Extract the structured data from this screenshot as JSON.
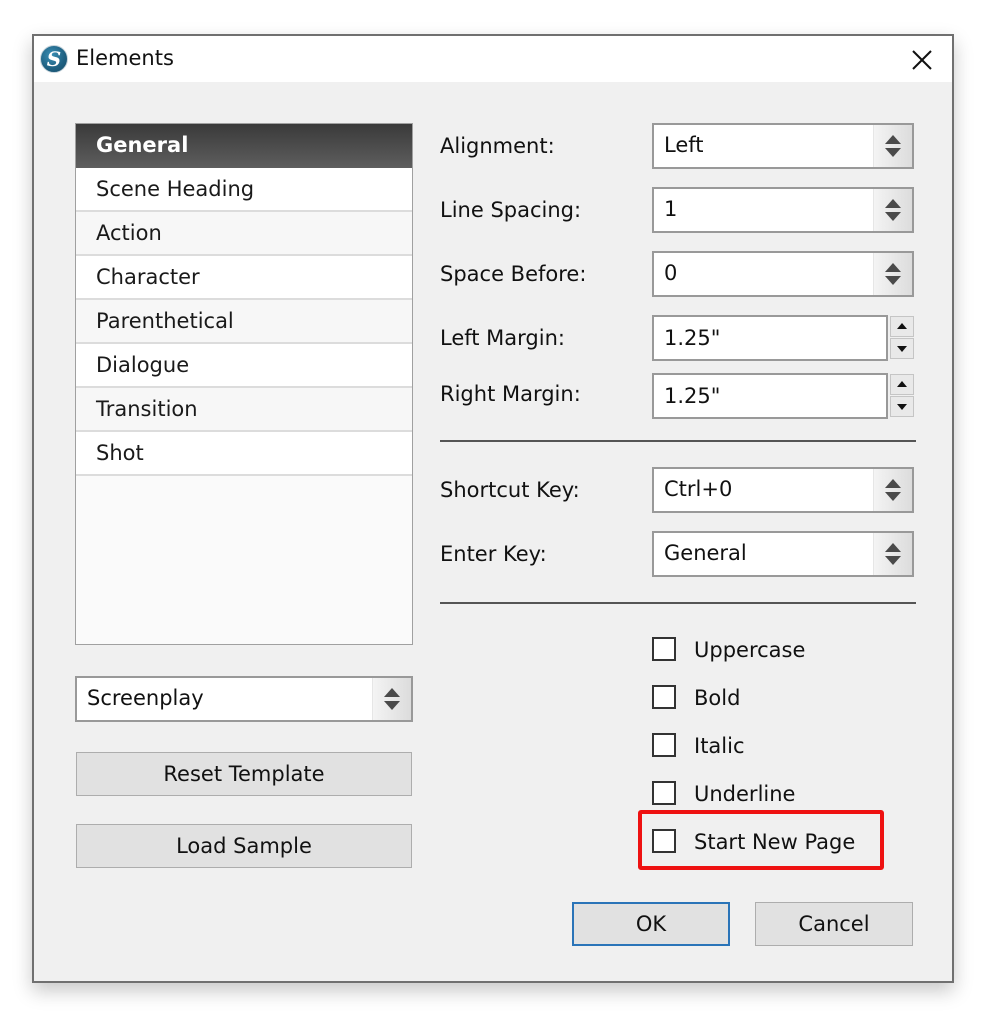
{
  "window": {
    "title": "Elements",
    "app_icon": "scrivener-logo-icon",
    "close_icon": "close-icon"
  },
  "element_list": {
    "selected_index": 0,
    "items": [
      {
        "label": "General"
      },
      {
        "label": "Scene Heading"
      },
      {
        "label": "Action"
      },
      {
        "label": "Character"
      },
      {
        "label": "Parenthetical"
      },
      {
        "label": "Dialogue"
      },
      {
        "label": "Transition"
      },
      {
        "label": "Shot"
      }
    ]
  },
  "template_select": {
    "value": "Screenplay"
  },
  "buttons": {
    "reset_template": "Reset Template",
    "load_sample": "Load Sample",
    "ok": "OK",
    "cancel": "Cancel"
  },
  "fields": {
    "alignment": {
      "label": "Alignment:",
      "value": "Left"
    },
    "line_spacing": {
      "label": "Line Spacing:",
      "value": "1"
    },
    "space_before": {
      "label": "Space Before:",
      "value": "0"
    },
    "left_margin": {
      "label": "Left Margin:",
      "value": "1.25\""
    },
    "right_margin": {
      "label": "Right Margin:",
      "value": "1.25\""
    },
    "shortcut_key": {
      "label": "Shortcut Key:",
      "value": "Ctrl+0"
    },
    "enter_key": {
      "label": "Enter Key:",
      "value": "General"
    }
  },
  "checkboxes": [
    {
      "label": "Uppercase",
      "checked": false
    },
    {
      "label": "Bold",
      "checked": false
    },
    {
      "label": "Italic",
      "checked": false
    },
    {
      "label": "Underline",
      "checked": false
    },
    {
      "label": "Start New Page",
      "checked": false,
      "highlighted": true
    }
  ],
  "colors": {
    "highlight": "#ee1111",
    "default_button_border": "#2a74b8",
    "selected_item_bg": "#4a4a4a"
  }
}
